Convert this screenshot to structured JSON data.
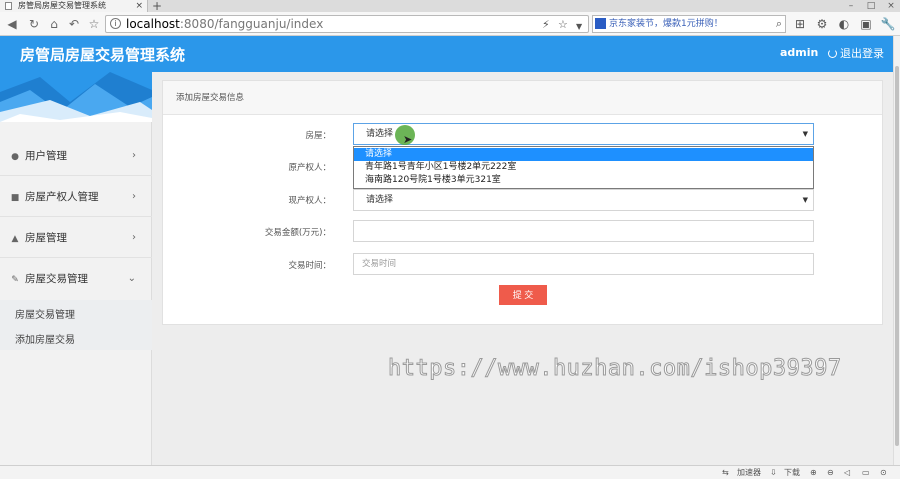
{
  "browser": {
    "tab_title": "房管局房屋交易管理系统",
    "tab_close": "×",
    "new_tab": "+",
    "url_host": "localhost",
    "url_path": ":8080/fangguanju/index",
    "search_text": "京东家装节，爆款1元拼购！",
    "win_min": "–",
    "win_max": "□",
    "win_close": "×"
  },
  "header": {
    "title": "房管局房屋交易管理系统",
    "user": "admin",
    "logout": "退出登录"
  },
  "sidebar": {
    "items": [
      {
        "label": "用户管理",
        "icon": "user-icon"
      },
      {
        "label": "房屋产权人管理",
        "icon": "owner-icon"
      },
      {
        "label": "房屋管理",
        "icon": "home-icon"
      },
      {
        "label": "房屋交易管理",
        "icon": "wrench-icon"
      }
    ],
    "sub_items": [
      "房屋交易管理",
      "添加房屋交易"
    ]
  },
  "panel": {
    "title": "添加房屋交易信息",
    "fields": {
      "house_label": "房屋：",
      "house_value": "请选择",
      "original_owner_label": "原产权人：",
      "current_owner_label": "现产权人：",
      "current_owner_value": "请选择",
      "amount_label": "交易金额(万元)：",
      "amount_value": "",
      "time_label": "交易时间：",
      "time_placeholder": "交易时间"
    },
    "dropdown_options": [
      "请选择",
      "青年路1号青年小区1号楼2单元222室",
      "海南路120号院1号楼3单元321室"
    ],
    "submit": "提 交"
  },
  "watermark": "https://www.huzhan.com/ishop39397",
  "statusbar": {
    "accelerator": "加速器",
    "download": "下载"
  }
}
